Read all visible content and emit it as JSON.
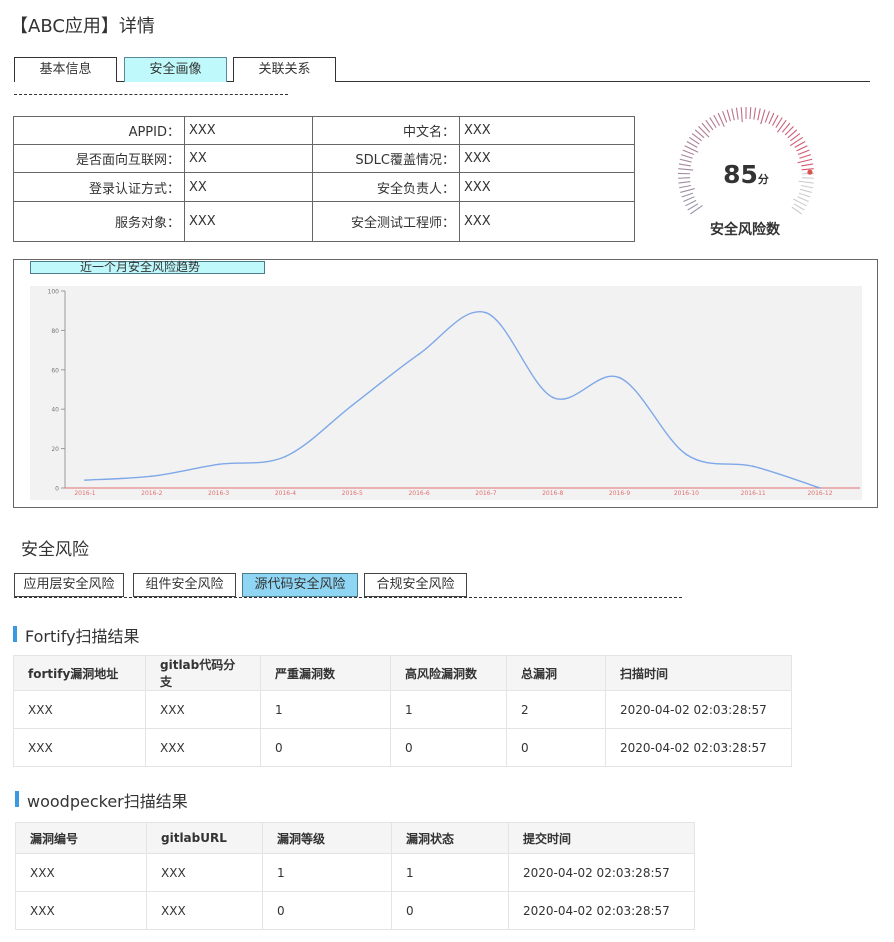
{
  "page": {
    "title": "【ABC应用】详情"
  },
  "top_tabs": [
    {
      "label": "基本信息",
      "active": false
    },
    {
      "label": "安全画像",
      "active": true
    },
    {
      "label": "关联关系",
      "active": false
    }
  ],
  "info": {
    "rows": [
      {
        "label1": "APPID：",
        "value1": "XXX",
        "label2": "中文名：",
        "value2": "XXX"
      },
      {
        "label1": "是否面向互联网：",
        "value1": "XX",
        "label2": "SDLC覆盖情况：",
        "value2": "XXX"
      },
      {
        "label1": "登录认证方式：",
        "value1": "XX",
        "label2": "安全负责人：",
        "value2": "XXX"
      },
      {
        "label1": "服务对象：",
        "value1": "XXX",
        "label2": "安全测试工程师：",
        "value2": "XXX"
      }
    ]
  },
  "gauge": {
    "score": "85",
    "unit": "分",
    "label": "安全风险数",
    "value": 85,
    "max": 100,
    "accent_color": "#d9534f"
  },
  "trend_chart": {
    "title": "近一个月安全风险趋势"
  },
  "chart_data": {
    "type": "line",
    "title": "近一个月安全风险趋势",
    "xlabel": "",
    "ylabel": "",
    "categories": [
      "2016-1",
      "2016-2",
      "2016-3",
      "2016-4",
      "2016-5",
      "2016-6",
      "2016-7",
      "2016-8",
      "2016-9",
      "2016-10",
      "2016-11",
      "2016-12"
    ],
    "values": [
      4,
      6,
      12,
      16,
      42,
      68,
      89,
      46,
      56,
      17,
      11,
      0
    ],
    "ylim": [
      0,
      100
    ],
    "yticks": [
      "0",
      "20",
      "40",
      "60",
      "80",
      "100"
    ],
    "grid": false,
    "line_color": "#7fa8e8",
    "axis_tick_color": "#e07070"
  },
  "risk": {
    "section_title": "安全风险",
    "tabs": [
      {
        "label": "应用层安全风险",
        "active": false
      },
      {
        "label": "组件安全风险",
        "active": false
      },
      {
        "label": "源代码安全风险",
        "active": true
      },
      {
        "label": "合规安全风险",
        "active": false
      }
    ]
  },
  "fortify": {
    "title": "Fortify扫描结果",
    "columns": [
      "fortify漏洞地址",
      "gitlab代码分支",
      "严重漏洞数",
      "高风险漏洞数",
      "总漏洞",
      "扫描时间"
    ],
    "rows": [
      [
        "XXX",
        "XXX",
        "1",
        "1",
        "2",
        "2020-04-02 02:03:28:57"
      ],
      [
        "XXX",
        "XXX",
        "0",
        "0",
        "0",
        "2020-04-02 02:03:28:57"
      ]
    ]
  },
  "woodpecker": {
    "title": "woodpecker扫描结果",
    "columns": [
      "漏洞编号",
      "gitlabURL",
      "漏洞等级",
      "漏洞状态",
      "提交时间"
    ],
    "rows": [
      [
        "XXX",
        "XXX",
        "1",
        "1",
        "2020-04-02 02:03:28:57"
      ],
      [
        "XXX",
        "XXX",
        "0",
        "0",
        "2020-04-02 02:03:28:57"
      ]
    ]
  }
}
